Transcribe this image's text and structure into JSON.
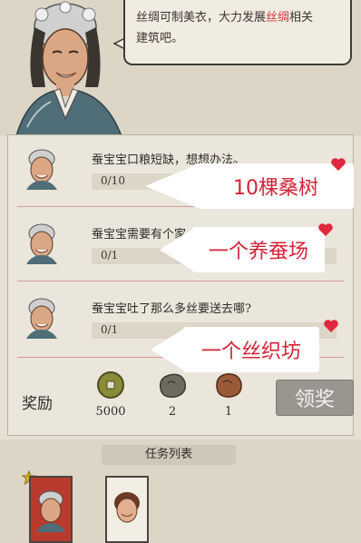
{
  "dialogue": {
    "line1_a": "丝绸可制美衣，大力发展",
    "line1_hl": "丝绸",
    "line1_b": "相关",
    "line2": "建筑吧。"
  },
  "quests": [
    {
      "title": "蚕宝宝口粮短缺，想想办法。",
      "progress": "0/10",
      "callout": "10棵桑树"
    },
    {
      "title": "蚕宝宝需要有个家。",
      "progress": "0/1",
      "callout": "一个养蚕场"
    },
    {
      "title": "蚕宝宝吐了那么多丝要送去哪?",
      "progress": "0/1",
      "callout": "一个丝织坊"
    }
  ],
  "rewards": {
    "label": "奖励",
    "items": [
      {
        "icon": "copper-coin-icon",
        "amount": "5000"
      },
      {
        "icon": "stone-ore-icon",
        "amount": "2"
      },
      {
        "icon": "copper-ore-icon",
        "amount": "1"
      }
    ],
    "claim_label": "领奖"
  },
  "task_list": {
    "title": "任务列表"
  },
  "colors": {
    "highlight": "#c8383f",
    "callout_text": "#d42336",
    "heart": "#e0283f",
    "claim_button": "#9a968f"
  }
}
